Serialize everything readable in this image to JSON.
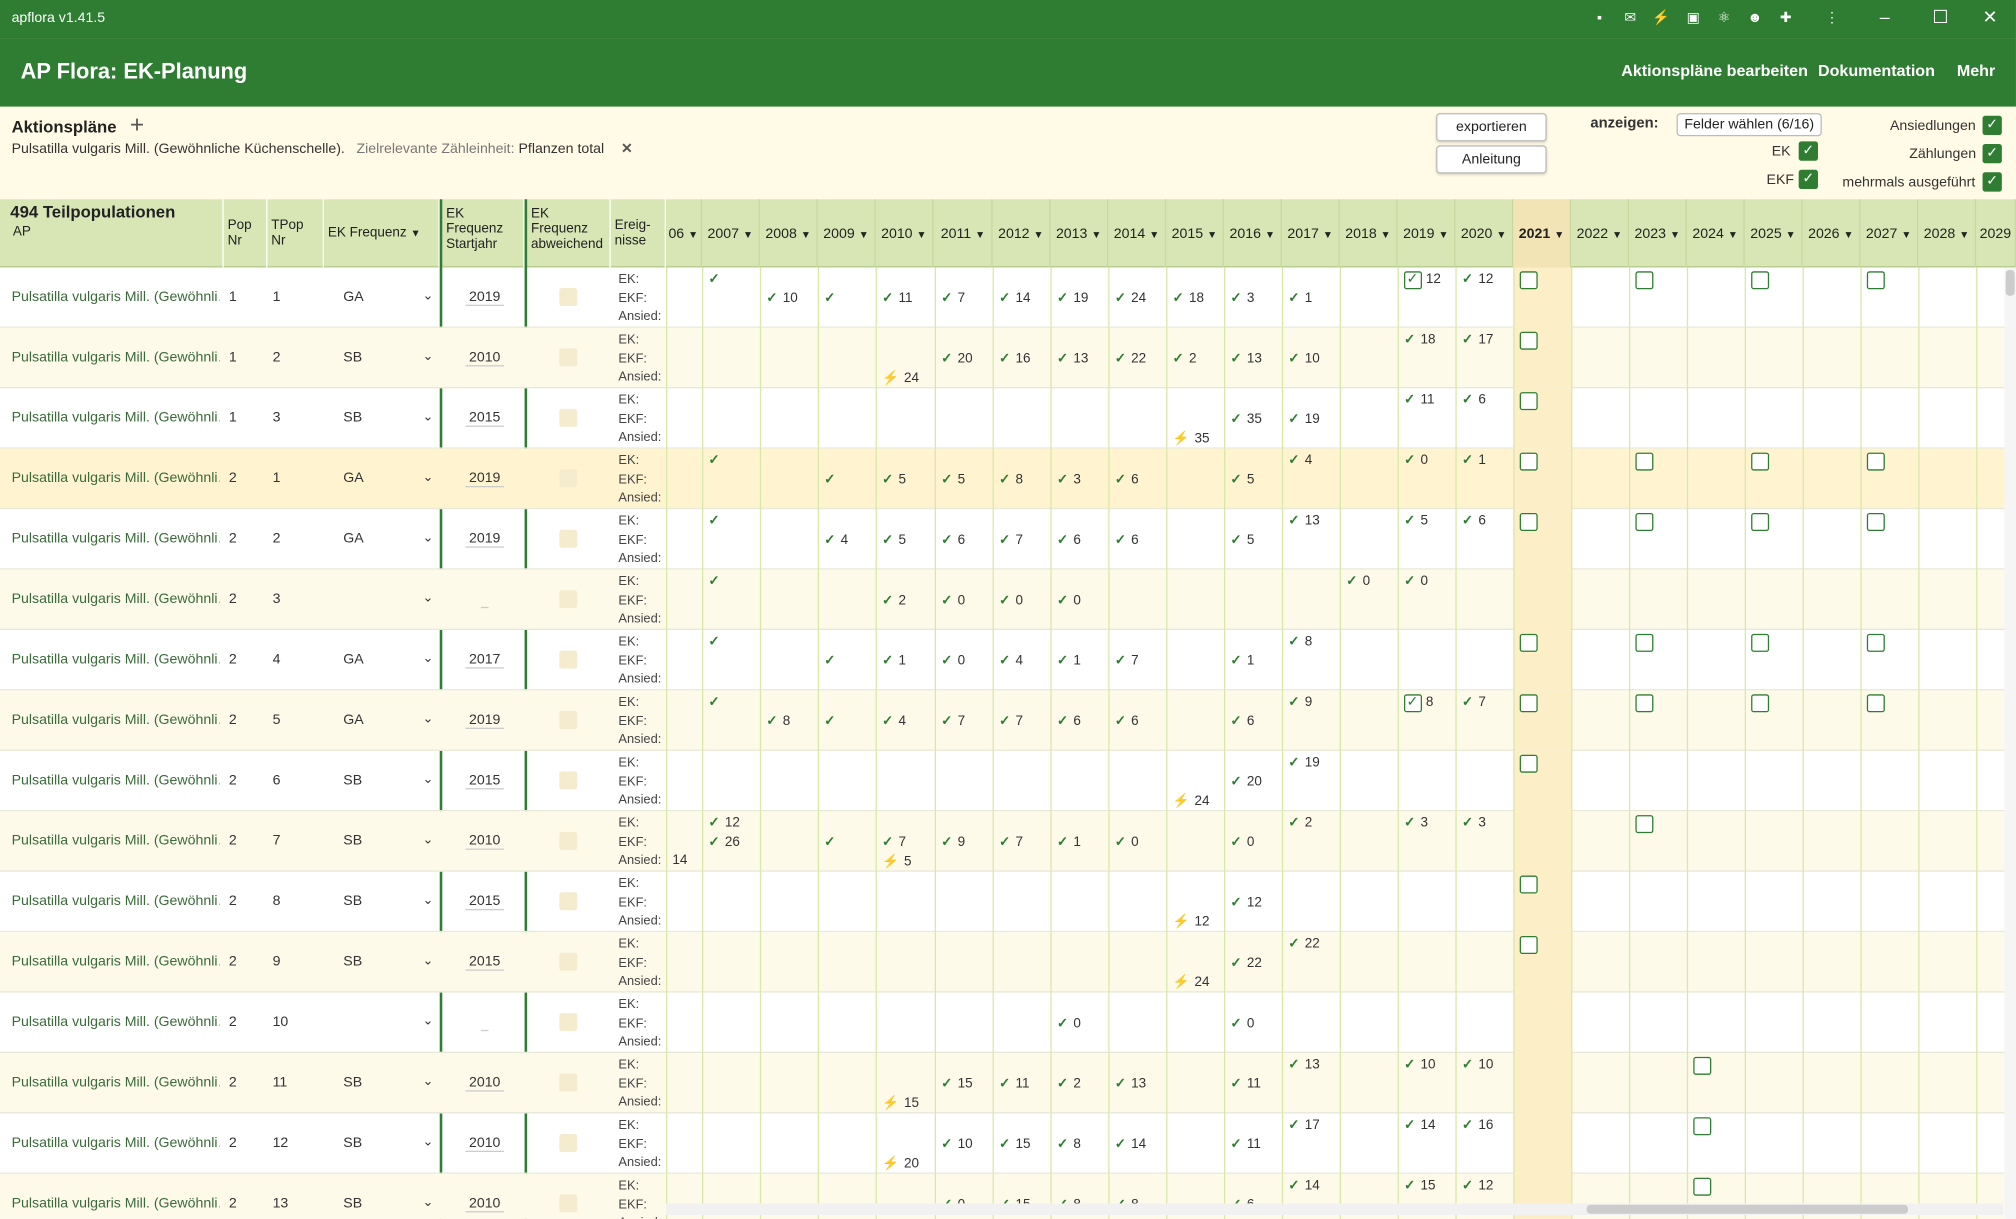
{
  "window": {
    "title": "apflora v1.41.5",
    "ext_icons": [
      "password-icon",
      "mail-icon",
      "bolt-icon",
      "extension-box-icon",
      "react-icon",
      "robot-icon",
      "puzzle-icon",
      "menu-dots-icon"
    ]
  },
  "app": {
    "title": "AP Flora: EK-Planung",
    "nav": [
      "Aktionspläne bearbeiten",
      "Dokumentation",
      "Mehr"
    ]
  },
  "toolbar": {
    "heading": "Aktionspläne",
    "ap_name": "Pulsatilla vulgaris Mill. (Gewöhnliche Küchenschelle).",
    "zaehl_label": "Zielrelevante Zähleinheit:",
    "zaehl_value": "Pflanzen total",
    "export_label": "exportieren",
    "anleitung_label": "Anleitung",
    "anzeigen_label": "anzeigen:",
    "felder_label": "Felder wählen (6/16)",
    "ek_label": "EK",
    "ekf_label": "EKF",
    "ansiedlungen_label": "Ansiedlungen",
    "zaehlungen_label": "Zählungen",
    "mehrmals_label": "mehrmals ausgeführt"
  },
  "table": {
    "count_label": "494 Teilpopulationen",
    "headers": {
      "ap": "AP",
      "pop": "Pop Nr",
      "tpop": "TPop Nr",
      "freq": "EK Frequenz",
      "start": "EK Frequenz Startjahr",
      "abw": "EK Frequenz abweichend",
      "ereig": "Ereig- nisse"
    },
    "years": [
      "06",
      "2007",
      "2008",
      "2009",
      "2010",
      "2011",
      "2012",
      "2013",
      "2014",
      "2015",
      "2016",
      "2017",
      "2018",
      "2019",
      "2020",
      "2021",
      "2022",
      "2023",
      "2024",
      "2025",
      "2026",
      "2027",
      "2028",
      "2029"
    ],
    "row_labels": {
      "ek": "EK:",
      "ekf": "EKF:",
      "ans": "Ansied:"
    },
    "rows": [
      {
        "ap": "Pulsatilla vulgaris Mill. (Gewöhnli…",
        "pop": "1",
        "tpop": "1",
        "freq": "GA",
        "start": "2019"
      },
      {
        "ap": "Pulsatilla vulgaris Mill. (Gewöhnli…",
        "pop": "1",
        "tpop": "2",
        "freq": "SB",
        "start": "2010"
      },
      {
        "ap": "Pulsatilla vulgaris Mill. (Gewöhnli…",
        "pop": "1",
        "tpop": "3",
        "freq": "SB",
        "start": "2015"
      },
      {
        "ap": "Pulsatilla vulgaris Mill. (Gewöhnli…",
        "pop": "2",
        "tpop": "1",
        "freq": "GA",
        "start": "2019"
      },
      {
        "ap": "Pulsatilla vulgaris Mill. (Gewöhnli…",
        "pop": "2",
        "tpop": "2",
        "freq": "GA",
        "start": "2019"
      },
      {
        "ap": "Pulsatilla vulgaris Mill. (Gewöhnli…",
        "pop": "2",
        "tpop": "3",
        "freq": "",
        "start": ""
      },
      {
        "ap": "Pulsatilla vulgaris Mill. (Gewöhnli…",
        "pop": "2",
        "tpop": "4",
        "freq": "GA",
        "start": "2017"
      },
      {
        "ap": "Pulsatilla vulgaris Mill. (Gewöhnli…",
        "pop": "2",
        "tpop": "5",
        "freq": "GA",
        "start": "2019"
      },
      {
        "ap": "Pulsatilla vulgaris Mill. (Gewöhnli…",
        "pop": "2",
        "tpop": "6",
        "freq": "SB",
        "start": "2015"
      },
      {
        "ap": "Pulsatilla vulgaris Mill. (Gewöhnli…",
        "pop": "2",
        "tpop": "7",
        "freq": "SB",
        "start": "2010"
      },
      {
        "ap": "Pulsatilla vulgaris Mill. (Gewöhnli…",
        "pop": "2",
        "tpop": "8",
        "freq": "SB",
        "start": "2015"
      },
      {
        "ap": "Pulsatilla vulgaris Mill. (Gewöhnli…",
        "pop": "2",
        "tpop": "9",
        "freq": "SB",
        "start": "2015"
      },
      {
        "ap": "Pulsatilla vulgaris Mill. (Gewöhnli…",
        "pop": "2",
        "tpop": "10",
        "freq": "",
        "start": ""
      },
      {
        "ap": "Pulsatilla vulgaris Mill. (Gewöhnli…",
        "pop": "2",
        "tpop": "11",
        "freq": "SB",
        "start": "2010"
      },
      {
        "ap": "Pulsatilla vulgaris Mill. (Gewöhnli…",
        "pop": "2",
        "tpop": "12",
        "freq": "SB",
        "start": "2010"
      },
      {
        "ap": "Pulsatilla vulgaris Mill. (Gewöhnli…",
        "pop": "2",
        "tpop": "13",
        "freq": "SB",
        "start": "2010"
      }
    ],
    "marks": [
      [
        [
          1,
          0,
          ""
        ],
        [
          2,
          1,
          "10"
        ],
        [
          3,
          1,
          ""
        ],
        [
          4,
          1,
          "11"
        ],
        [
          5,
          1,
          "7"
        ],
        [
          6,
          1,
          "14"
        ],
        [
          7,
          1,
          "19"
        ],
        [
          8,
          1,
          "24"
        ],
        [
          9,
          1,
          "18"
        ],
        [
          10,
          1,
          "3"
        ],
        [
          11,
          1,
          "1"
        ],
        [
          13,
          0,
          "12",
          "cb"
        ],
        [
          14,
          0,
          "12"
        ],
        [
          15,
          0,
          "",
          "e"
        ],
        [
          17,
          0,
          "",
          "e"
        ],
        [
          19,
          0,
          "",
          "e"
        ],
        [
          21,
          0,
          "",
          "e"
        ]
      ],
      [
        [
          4,
          2,
          "24",
          "a"
        ],
        [
          5,
          1,
          "20"
        ],
        [
          6,
          1,
          "16"
        ],
        [
          7,
          1,
          "13"
        ],
        [
          8,
          1,
          "22"
        ],
        [
          9,
          1,
          "2"
        ],
        [
          10,
          1,
          "13"
        ],
        [
          11,
          1,
          "10"
        ],
        [
          13,
          0,
          "18"
        ],
        [
          14,
          0,
          "17"
        ],
        [
          15,
          0,
          "",
          "e"
        ]
      ],
      [
        [
          9,
          2,
          "35",
          "a"
        ],
        [
          10,
          1,
          "35"
        ],
        [
          11,
          1,
          "19"
        ],
        [
          13,
          0,
          "11"
        ],
        [
          14,
          0,
          "6"
        ],
        [
          15,
          0,
          "",
          "e"
        ]
      ],
      [
        [
          1,
          0,
          ""
        ],
        [
          3,
          1,
          ""
        ],
        [
          4,
          1,
          "5"
        ],
        [
          5,
          1,
          "5"
        ],
        [
          6,
          1,
          "8"
        ],
        [
          7,
          1,
          "3"
        ],
        [
          8,
          1,
          "6"
        ],
        [
          10,
          1,
          "5"
        ],
        [
          11,
          0,
          "4"
        ],
        [
          13,
          0,
          "0"
        ],
        [
          14,
          0,
          "1"
        ],
        [
          15,
          0,
          "",
          "e"
        ],
        [
          17,
          0,
          "",
          "e"
        ],
        [
          19,
          0,
          "",
          "e"
        ],
        [
          21,
          0,
          "",
          "e"
        ]
      ],
      [
        [
          1,
          0,
          ""
        ],
        [
          3,
          1,
          "4"
        ],
        [
          4,
          1,
          "5"
        ],
        [
          5,
          1,
          "6"
        ],
        [
          6,
          1,
          "7"
        ],
        [
          7,
          1,
          "6"
        ],
        [
          8,
          1,
          "6"
        ],
        [
          10,
          1,
          "5"
        ],
        [
          11,
          0,
          "13"
        ],
        [
          13,
          0,
          "5"
        ],
        [
          14,
          0,
          "6"
        ],
        [
          15,
          0,
          "",
          "e"
        ],
        [
          17,
          0,
          "",
          "e"
        ],
        [
          19,
          0,
          "",
          "e"
        ],
        [
          21,
          0,
          "",
          "e"
        ]
      ],
      [
        [
          1,
          0,
          ""
        ],
        [
          4,
          1,
          "2"
        ],
        [
          5,
          1,
          "0"
        ],
        [
          6,
          1,
          "0"
        ],
        [
          7,
          1,
          "0"
        ],
        [
          12,
          0,
          "0"
        ],
        [
          13,
          0,
          "0"
        ]
      ],
      [
        [
          1,
          0,
          ""
        ],
        [
          3,
          1,
          ""
        ],
        [
          4,
          1,
          "1"
        ],
        [
          5,
          1,
          "0"
        ],
        [
          6,
          1,
          "4"
        ],
        [
          7,
          1,
          "1"
        ],
        [
          8,
          1,
          "7"
        ],
        [
          10,
          1,
          "1"
        ],
        [
          11,
          0,
          "8"
        ],
        [
          15,
          0,
          "",
          "e"
        ],
        [
          17,
          0,
          "",
          "e"
        ],
        [
          19,
          0,
          "",
          "e"
        ],
        [
          21,
          0,
          "",
          "e"
        ]
      ],
      [
        [
          1,
          0,
          ""
        ],
        [
          2,
          1,
          "8"
        ],
        [
          3,
          1,
          ""
        ],
        [
          4,
          1,
          "4"
        ],
        [
          5,
          1,
          "7"
        ],
        [
          6,
          1,
          "7"
        ],
        [
          7,
          1,
          "6"
        ],
        [
          8,
          1,
          "6"
        ],
        [
          10,
          1,
          "6"
        ],
        [
          11,
          0,
          "9"
        ],
        [
          13,
          0,
          "8",
          "cb"
        ],
        [
          14,
          0,
          "7"
        ],
        [
          15,
          0,
          "",
          "e"
        ],
        [
          17,
          0,
          "",
          "e"
        ],
        [
          19,
          0,
          "",
          "e"
        ],
        [
          21,
          0,
          "",
          "e"
        ]
      ],
      [
        [
          9,
          2,
          "24",
          "a"
        ],
        [
          10,
          1,
          "20"
        ],
        [
          11,
          0,
          "19"
        ],
        [
          15,
          0,
          "",
          "e"
        ]
      ],
      [
        [
          0,
          2,
          "14",
          "t"
        ],
        [
          1,
          0,
          "12"
        ],
        [
          1,
          1,
          "26"
        ],
        [
          3,
          1,
          ""
        ],
        [
          4,
          1,
          "7"
        ],
        [
          4,
          2,
          "5",
          "a"
        ],
        [
          5,
          1,
          "9"
        ],
        [
          6,
          1,
          "7"
        ],
        [
          7,
          1,
          "1"
        ],
        [
          8,
          1,
          "0"
        ],
        [
          10,
          1,
          "0"
        ],
        [
          11,
          0,
          "2"
        ],
        [
          13,
          0,
          "3"
        ],
        [
          14,
          0,
          "3"
        ],
        [
          17,
          0,
          "",
          "e"
        ]
      ],
      [
        [
          9,
          2,
          "12",
          "a"
        ],
        [
          10,
          1,
          "12"
        ],
        [
          15,
          0,
          "",
          "e"
        ]
      ],
      [
        [
          9,
          2,
          "24",
          "a"
        ],
        [
          10,
          1,
          "22"
        ],
        [
          11,
          0,
          "22"
        ],
        [
          15,
          0,
          "",
          "e"
        ]
      ],
      [
        [
          7,
          1,
          "0"
        ],
        [
          10,
          1,
          "0"
        ]
      ],
      [
        [
          4,
          2,
          "15",
          "a"
        ],
        [
          5,
          1,
          "15"
        ],
        [
          6,
          1,
          "11"
        ],
        [
          7,
          1,
          "2"
        ],
        [
          8,
          1,
          "13"
        ],
        [
          10,
          1,
          "11"
        ],
        [
          11,
          0,
          "13"
        ],
        [
          13,
          0,
          "10"
        ],
        [
          14,
          0,
          "10"
        ],
        [
          18,
          0,
          "",
          "e"
        ]
      ],
      [
        [
          4,
          2,
          "20",
          "a"
        ],
        [
          5,
          1,
          "10"
        ],
        [
          6,
          1,
          "15"
        ],
        [
          7,
          1,
          "8"
        ],
        [
          8,
          1,
          "14"
        ],
        [
          10,
          1,
          "11"
        ],
        [
          11,
          0,
          "17"
        ],
        [
          13,
          0,
          "14"
        ],
        [
          14,
          0,
          "16"
        ],
        [
          18,
          0,
          "",
          "e"
        ]
      ],
      [
        [
          5,
          1,
          "0"
        ],
        [
          6,
          1,
          "15"
        ],
        [
          7,
          1,
          "8"
        ],
        [
          8,
          1,
          "8"
        ],
        [
          10,
          1,
          "6"
        ],
        [
          11,
          0,
          "14"
        ],
        [
          13,
          0,
          "15"
        ],
        [
          14,
          0,
          "12"
        ],
        [
          18,
          0,
          "",
          "e"
        ]
      ]
    ]
  },
  "colors": {
    "primary": "#2e7d32",
    "header_bg": "#d8e6b6",
    "current_year": "#fcefc8"
  }
}
